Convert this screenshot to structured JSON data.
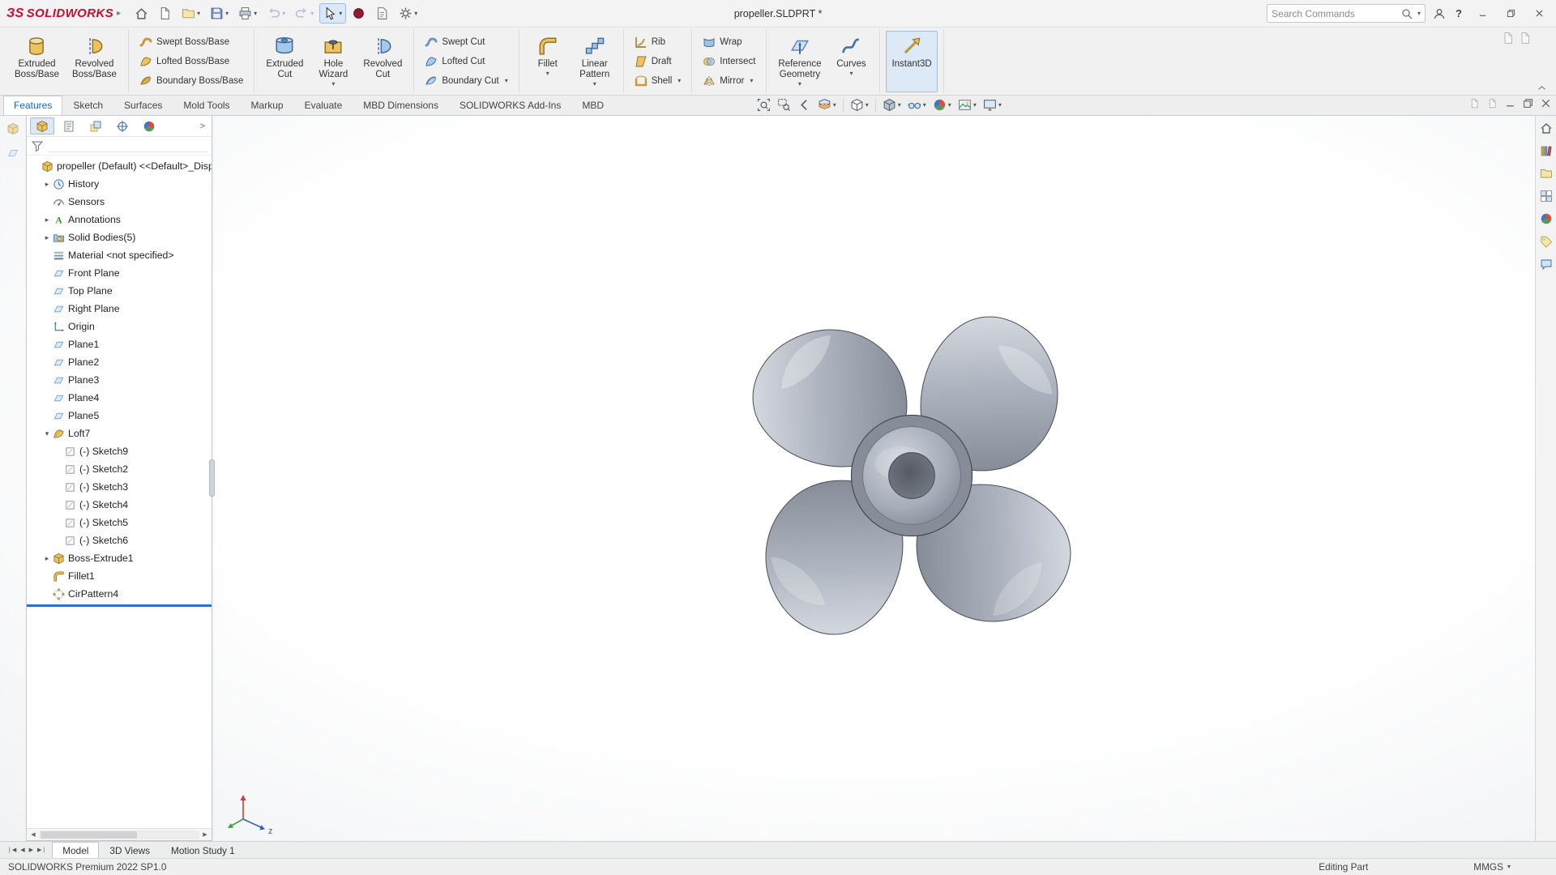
{
  "titlebar": {
    "brand_mark": "ЗS",
    "brand": "SOLIDWORKS",
    "title": "propeller.SLDPRT *",
    "search_placeholder": "Search Commands",
    "qat": [
      {
        "name": "home-button",
        "icon": "house-icon"
      },
      {
        "name": "new-document-button",
        "icon": "page-icon"
      },
      {
        "name": "open-button",
        "icon": "folder-icon",
        "dropdown": true
      },
      {
        "name": "save-button",
        "icon": "save-icon",
        "dropdown": true
      },
      {
        "name": "print-button",
        "icon": "print-icon",
        "dropdown": true
      },
      {
        "name": "undo-button",
        "icon": "undo-icon",
        "dropdown": true,
        "disabled": true
      },
      {
        "name": "redo-button",
        "icon": "redo-icon",
        "dropdown": true,
        "disabled": true
      },
      {
        "name": "select-button",
        "icon": "cursor-icon",
        "dropdown": true,
        "active": true
      },
      {
        "name": "rebuild-button",
        "icon": "rebuild-icon"
      },
      {
        "name": "file-properties-button",
        "icon": "file-properties-icon"
      },
      {
        "name": "options-button",
        "icon": "gear-icon",
        "dropdown": true
      }
    ]
  },
  "ribbon": {
    "groups": [
      {
        "type": "big",
        "buttons": [
          {
            "label": "Extruded\nBoss/Base",
            "icon": "extruded-boss-icon"
          },
          {
            "label": "Revolved\nBoss/Base",
            "icon": "revolved-boss-icon"
          }
        ]
      },
      {
        "type": "small",
        "buttons": [
          {
            "label": "Swept Boss/Base",
            "icon": "swept-boss-icon"
          },
          {
            "label": "Lofted Boss/Base",
            "icon": "lofted-boss-icon"
          },
          {
            "label": "Boundary Boss/Base",
            "icon": "boundary-boss-icon"
          }
        ]
      },
      {
        "type": "big",
        "buttons": [
          {
            "label": "Extruded\nCut",
            "icon": "extruded-cut-icon"
          },
          {
            "label": "Hole\nWizard",
            "icon": "hole-wizard-icon",
            "dropdown": true
          },
          {
            "label": "Revolved\nCut",
            "icon": "revolved-cut-icon"
          }
        ]
      },
      {
        "type": "small",
        "buttons": [
          {
            "label": "Swept Cut",
            "icon": "swept-cut-icon"
          },
          {
            "label": "Lofted Cut",
            "icon": "lofted-cut-icon"
          },
          {
            "label": "Boundary Cut",
            "icon": "boundary-cut-icon",
            "dropdown": true
          }
        ]
      },
      {
        "type": "big",
        "buttons": [
          {
            "label": "Fillet",
            "icon": "fillet-icon",
            "dropdown": true
          },
          {
            "label": "Linear\nPattern",
            "icon": "linear-pattern-icon",
            "dropdown": true
          }
        ]
      },
      {
        "type": "small",
        "buttons": [
          {
            "label": "Rib",
            "icon": "rib-icon"
          },
          {
            "label": "Draft",
            "icon": "draft-icon"
          },
          {
            "label": "Shell",
            "icon": "shell-icon",
            "dropdown": true
          }
        ]
      },
      {
        "type": "small",
        "buttons": [
          {
            "label": "Wrap",
            "icon": "wrap-icon"
          },
          {
            "label": "Intersect",
            "icon": "intersect-icon"
          },
          {
            "label": "Mirror",
            "icon": "mirror-icon",
            "dropdown": true
          }
        ]
      },
      {
        "type": "big",
        "buttons": [
          {
            "label": "Reference\nGeometry",
            "icon": "reference-geometry-icon",
            "dropdown": true
          },
          {
            "label": "Curves",
            "icon": "curves-icon",
            "dropdown": true
          }
        ]
      },
      {
        "type": "big",
        "buttons": [
          {
            "label": "Instant3D",
            "icon": "instant3d-icon",
            "active": true
          }
        ]
      }
    ]
  },
  "command_tabs": [
    {
      "label": "Features",
      "active": true
    },
    {
      "label": "Sketch"
    },
    {
      "label": "Surfaces"
    },
    {
      "label": "Mold Tools"
    },
    {
      "label": "Markup"
    },
    {
      "label": "Evaluate"
    },
    {
      "label": "MBD Dimensions"
    },
    {
      "label": "SOLIDWORKS Add-Ins"
    },
    {
      "label": "MBD"
    }
  ],
  "headsup": [
    {
      "name": "zoom-to-fit",
      "icon": "zoom-fit-icon"
    },
    {
      "name": "zoom-to-area",
      "icon": "zoom-area-icon"
    },
    {
      "name": "previous-view",
      "icon": "previous-view-icon"
    },
    {
      "name": "section-view",
      "icon": "section-view-icon",
      "dropdown": true
    },
    {
      "name": "view-orientation",
      "icon": "view-orientation-icon",
      "dropdown": true,
      "sep_before": true
    },
    {
      "name": "display-style",
      "icon": "display-style-icon",
      "dropdown": true,
      "sep_before": true
    },
    {
      "name": "hide-show-items",
      "icon": "hide-show-icon",
      "dropdown": true
    },
    {
      "name": "edit-appearance",
      "icon": "appearance-icon",
      "dropdown": true
    },
    {
      "name": "apply-scene",
      "icon": "scene-icon",
      "dropdown": true
    },
    {
      "name": "view-settings",
      "icon": "view-settings-icon",
      "dropdown": true
    }
  ],
  "feature_tree": {
    "panel_tabs": [
      {
        "name": "featuremanager-tab",
        "icon": "feature-manager-icon",
        "active": true
      },
      {
        "name": "propertymanager-tab",
        "icon": "property-manager-icon"
      },
      {
        "name": "configurationmanager-tab",
        "icon": "configuration-icon"
      },
      {
        "name": "dimxpertmanager-tab",
        "icon": "dimxpert-icon"
      },
      {
        "name": "displaymanager-tab",
        "icon": "display-manager-icon"
      }
    ],
    "panel_tabs_overflow": ">",
    "root_label": "propeller (Default) <<Default>_Displa",
    "items": [
      {
        "label": "History",
        "icon": "history-icon",
        "level": 1,
        "expander": "collapsed"
      },
      {
        "label": "Sensors",
        "icon": "sensors-icon",
        "level": 1
      },
      {
        "label": "Annotations",
        "icon": "annotations-icon",
        "level": 1,
        "expander": "collapsed"
      },
      {
        "label": "Solid Bodies(5)",
        "icon": "solid-bodies-icon",
        "level": 1,
        "expander": "collapsed"
      },
      {
        "label": "Material <not specified>",
        "icon": "material-icon",
        "level": 1
      },
      {
        "label": "Front Plane",
        "icon": "plane-icon",
        "level": 1
      },
      {
        "label": "Top Plane",
        "icon": "plane-icon",
        "level": 1
      },
      {
        "label": "Right Plane",
        "icon": "plane-icon",
        "level": 1
      },
      {
        "label": "Origin",
        "icon": "origin-icon",
        "level": 1
      },
      {
        "label": "Plane1",
        "icon": "plane-icon",
        "level": 1
      },
      {
        "label": "Plane2",
        "icon": "plane-icon",
        "level": 1
      },
      {
        "label": "Plane3",
        "icon": "plane-icon",
        "level": 1
      },
      {
        "label": "Plane4",
        "icon": "plane-icon",
        "level": 1
      },
      {
        "label": "Plane5",
        "icon": "plane-icon",
        "level": 1
      },
      {
        "label": "Loft7",
        "icon": "loft-icon",
        "level": 1,
        "expander": "expanded"
      },
      {
        "label": "(-) Sketch9",
        "icon": "sketch-icon",
        "level": 2
      },
      {
        "label": "(-) Sketch2",
        "icon": "sketch-icon",
        "level": 2
      },
      {
        "label": "(-) Sketch3",
        "icon": "sketch-icon",
        "level": 2
      },
      {
        "label": "(-) Sketch4",
        "icon": "sketch-icon",
        "level": 2
      },
      {
        "label": "(-) Sketch5",
        "icon": "sketch-icon",
        "level": 2
      },
      {
        "label": "(-) Sketch6",
        "icon": "sketch-icon",
        "level": 2
      },
      {
        "label": "Boss-Extrude1",
        "icon": "boss-extrude-icon",
        "level": 1,
        "expander": "collapsed"
      },
      {
        "label": "Fillet1",
        "icon": "fillet-icon",
        "level": 1
      },
      {
        "label": "CirPattern4",
        "icon": "cirpattern-icon",
        "level": 1
      }
    ]
  },
  "task_pane": [
    {
      "name": "solidworks-resources",
      "icon": "home-icon"
    },
    {
      "name": "design-library",
      "icon": "design-library-icon"
    },
    {
      "name": "file-explorer",
      "icon": "file-explorer-icon"
    },
    {
      "name": "view-palette",
      "icon": "view-palette-icon"
    },
    {
      "name": "appearances-scenes",
      "icon": "appearances-icon"
    },
    {
      "name": "custom-properties",
      "icon": "custom-properties-icon"
    },
    {
      "name": "solidworks-forum",
      "icon": "forum-icon"
    }
  ],
  "model_tabs": [
    {
      "label": "Model",
      "active": true
    },
    {
      "label": "3D Views"
    },
    {
      "label": "Motion Study 1"
    }
  ],
  "statusbar": {
    "left": "SOLIDWORKS Premium 2022 SP1.0",
    "mode": "Editing Part",
    "units": "MMGS"
  }
}
